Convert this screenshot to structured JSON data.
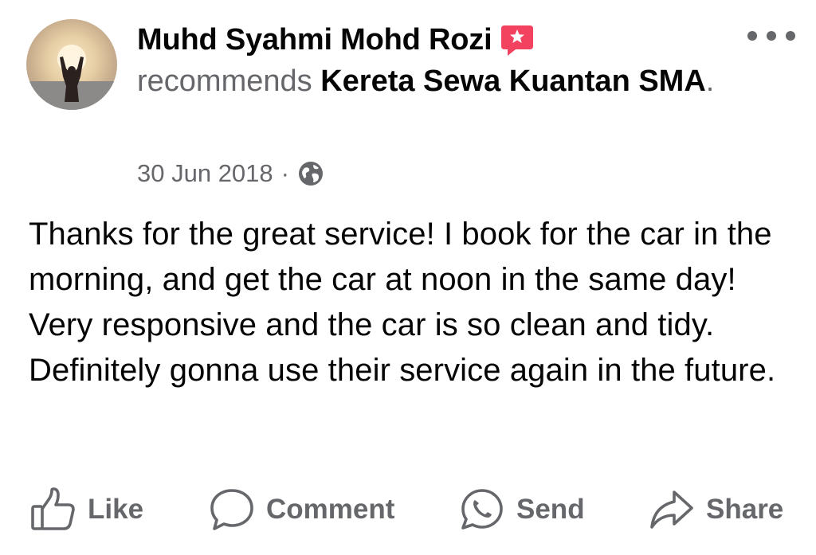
{
  "post": {
    "author": "Muhd Syahmi Mohd Rozi",
    "verb": "recommends",
    "page": "Kereta Sewa Kuantan SMA",
    "period": ".",
    "date": "30 Jun 2018",
    "separator": "·",
    "privacy_icon": "globe-icon",
    "badge_icon": "recommend-badge-icon",
    "body": "Thanks for the great service! I book for the car in the morning, and get the car at noon in the same day! Very responsive and the car is so clean and tidy. Definitely gonna use their service again in the future."
  },
  "actions": {
    "like": "Like",
    "comment": "Comment",
    "send": "Send",
    "share": "Share"
  },
  "colors": {
    "text_primary": "#050505",
    "text_secondary": "#65676b",
    "badge": "#f3425f"
  }
}
